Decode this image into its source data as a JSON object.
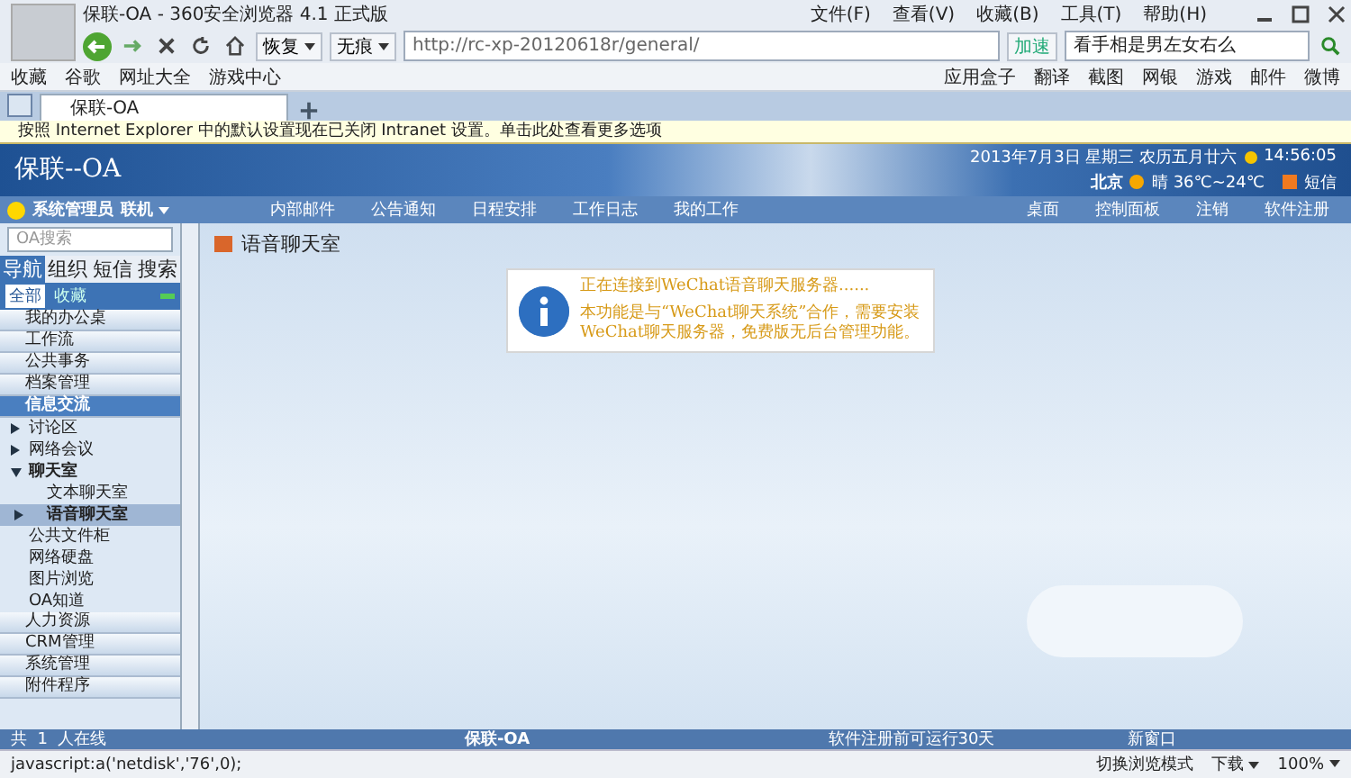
{
  "window": {
    "title": "保联-OA - 360安全浏览器 4.1 正式版",
    "menu": [
      "文件(F)",
      "查看(V)",
      "收藏(B)",
      "工具(T)",
      "帮助(H)"
    ]
  },
  "navbar": {
    "restore": "恢复",
    "private": "无痕",
    "url": "http://rc-xp-20120618r/general/",
    "speedup": "加速",
    "search": "看手相是男左女右么"
  },
  "favorites": {
    "left": [
      "收藏",
      "谷歌",
      "网址大全",
      "游戏中心"
    ],
    "right": [
      "应用盒子",
      "翻译",
      "截图",
      "网银",
      "游戏",
      "邮件",
      "微博"
    ]
  },
  "tabs": [
    {
      "label": "保联-OA",
      "selected": true
    }
  ],
  "infobar": "按照 Internet Explorer 中的默认设置现在已关闭 Intranet 设置。单击此处查看更多选项",
  "oa": {
    "logo": "保联--OA",
    "date": "2013年7月3日 星期三 农历五月廿六",
    "time": "14:56:05",
    "city": "北京",
    "weather": "晴 36℃~24℃",
    "sms": "短信",
    "user": "系统管理员",
    "status": "联机",
    "tools": [
      "内部邮件",
      "公告通知",
      "日程安排",
      "工作日志",
      "我的工作"
    ],
    "right_tools": [
      "桌面",
      "控制面板",
      "注销",
      "软件注册"
    ]
  },
  "sidebar": {
    "search": {
      "placeholder": "OA搜索"
    },
    "tabs": [
      {
        "label": "导航",
        "selected": true
      },
      {
        "label": "组织",
        "selected": false
      },
      {
        "label": "短信",
        "selected": false
      },
      {
        "label": "搜索",
        "selected": false
      }
    ],
    "subtabs": [
      {
        "label": "全部",
        "selected": true
      },
      {
        "label": "收藏",
        "selected": false
      }
    ],
    "menu": [
      {
        "label": "我的办公桌",
        "expanded": false
      },
      {
        "label": "工作流",
        "expanded": false
      },
      {
        "label": "公共事务",
        "expanded": false
      },
      {
        "label": "档案管理",
        "expanded": false
      },
      {
        "label": "信息交流",
        "expanded": true,
        "children": [
          {
            "label": "讨论区",
            "expanded": false
          },
          {
            "label": "网络会议",
            "expanded": false
          },
          {
            "label": "聊天室",
            "expanded": true,
            "children": [
              {
                "label": "文本聊天室",
                "selected": false
              },
              {
                "label": "语音聊天室",
                "selected": true
              }
            ]
          },
          {
            "label": "公共文件柜"
          },
          {
            "label": "网络硬盘"
          },
          {
            "label": "图片浏览"
          },
          {
            "label": "OA知道"
          }
        ]
      },
      {
        "label": "人力资源",
        "expanded": false
      },
      {
        "label": "CRM管理",
        "expanded": false
      },
      {
        "label": "系统管理",
        "expanded": false
      },
      {
        "label": "附件程序",
        "expanded": false
      }
    ]
  },
  "page": {
    "title": "语音聊天室",
    "message": [
      "正在连接到WeChat语音聊天服务器......",
      "本功能是与“WeChat聊天系统”合作，需要安装WeChat聊天服务器，免费版无后台管理功能。"
    ]
  },
  "footer": {
    "online": "共  1  人在线",
    "name": "保联-OA",
    "trial": "软件注册前可运行30天",
    "newwin": "新窗口"
  },
  "status_bar": {
    "text": "javascript:a('netdisk','76',0);",
    "mode": "切换浏览模式",
    "download": "下载",
    "zoom": "100%"
  }
}
